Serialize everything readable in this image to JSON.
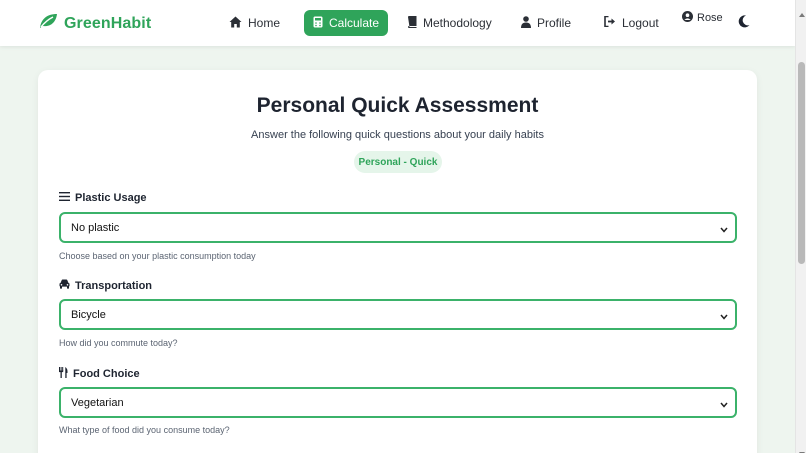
{
  "brand": {
    "name": "GreenHabit",
    "icon": "leaf-icon",
    "color": "#2fa45a"
  },
  "nav": {
    "items": [
      {
        "label": "Home",
        "icon": "home-icon",
        "active": false
      },
      {
        "label": "Calculate",
        "icon": "calculator-icon",
        "active": true
      },
      {
        "label": "Methodology",
        "icon": "book-icon",
        "active": false
      },
      {
        "label": "Profile",
        "icon": "user-icon",
        "active": false
      },
      {
        "label": "Logout",
        "icon": "logout-icon",
        "active": false
      }
    ],
    "user": {
      "name": "Rose",
      "icon": "user-circle-icon"
    },
    "theme_toggle_icon": "moon-icon"
  },
  "assessment": {
    "title": "Personal Quick Assessment",
    "subtitle": "Answer the following quick questions about your daily habits",
    "badge": "Personal - Quick",
    "fields": [
      {
        "label": "Plastic Usage",
        "icon": "layers-icon",
        "value": "No plastic",
        "help": "Choose based on your plastic consumption today"
      },
      {
        "label": "Transportation",
        "icon": "car-icon",
        "value": "Bicycle",
        "help": "How did you commute today?"
      },
      {
        "label": "Food Choice",
        "icon": "utensils-icon",
        "value": "Vegetarian",
        "help": "What type of food did you consume today?"
      }
    ]
  },
  "colors": {
    "accent": "#2fa45a",
    "border": "#3bb26a",
    "badge_bg": "#e5f5ea",
    "page_bg": "#eef5ef"
  }
}
